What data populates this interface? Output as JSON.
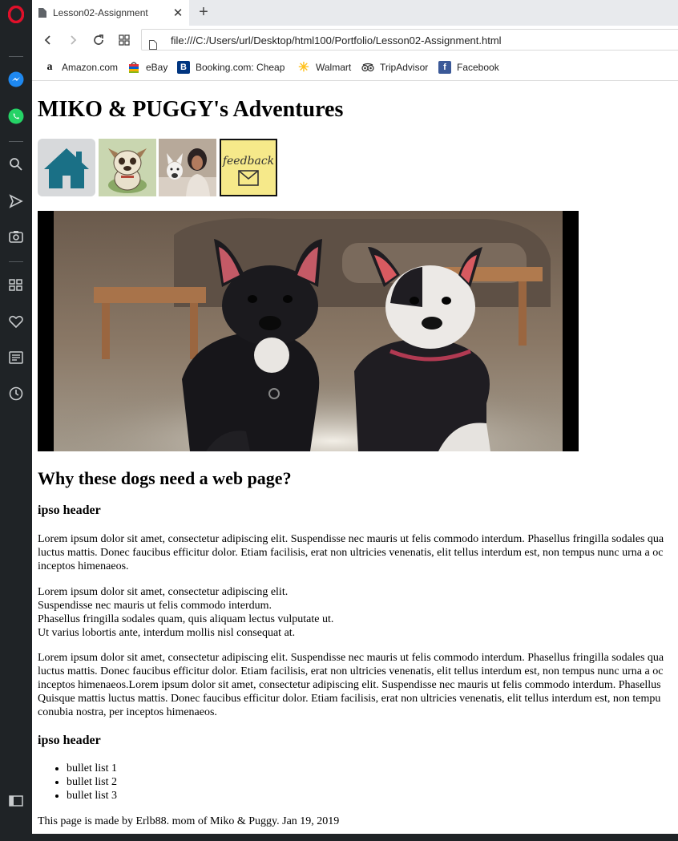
{
  "browser": {
    "tab": {
      "title": "Lesson02-Assignment",
      "close": "✕"
    },
    "new_tab": "+",
    "url": "file:///C:/Users/url/Desktop/html100/Portfolio/Lesson02-Assignment.html",
    "bookmarks": [
      {
        "label": "Amazon.com",
        "icon": "amazon-icon"
      },
      {
        "label": "eBay",
        "icon": "ebay-icon"
      },
      {
        "label": "Booking.com: Cheap",
        "icon": "booking-icon"
      },
      {
        "label": "Walmart",
        "icon": "walmart-icon"
      },
      {
        "label": "TripAdvisor",
        "icon": "tripadvisor-icon"
      },
      {
        "label": "Facebook",
        "icon": "facebook-icon"
      }
    ],
    "sidebar_icons": [
      "opera-logo-icon",
      "messenger-icon",
      "whatsapp-icon",
      "search-icon",
      "send-icon",
      "camera-icon",
      "speed-dial-icon",
      "heart-icon",
      "news-icon",
      "history-icon",
      "sidebar-toggle-icon"
    ]
  },
  "page": {
    "title": "MIKO & PUGGY's Adventures",
    "nav_images": [
      "home-icon",
      "puppy-drawing",
      "person-with-dog-photo",
      "feedback-note-icon"
    ],
    "feedback_text": "feedback",
    "h2": "Why these dogs need a web page?",
    "section1_header": "ipso header",
    "para1": [
      "Lorem ipsum dolor sit amet, consectetur adipiscing elit. Suspendisse nec mauris ut felis commodo interdum. Phasellus fringilla sodales qua",
      "luctus mattis. Donec faucibus efficitur dolor. Etiam facilisis, erat non ultricies venenatis, elit tellus interdum est, non tempus nunc urna a oc",
      "inceptos himenaeos."
    ],
    "para2": [
      "Lorem ipsum dolor sit amet, consectetur adipiscing elit.",
      "Suspendisse nec mauris ut felis commodo interdum.",
      "Phasellus fringilla sodales quam, quis aliquam lectus vulputate ut.",
      "Ut varius lobortis ante, interdum mollis nisl consequat at."
    ],
    "para3": [
      "Lorem ipsum dolor sit amet, consectetur adipiscing elit. Suspendisse nec mauris ut felis commodo interdum. Phasellus fringilla sodales qua",
      "luctus mattis. Donec faucibus efficitur dolor. Etiam facilisis, erat non ultricies venenatis, elit tellus interdum est, non tempus nunc urna a oc",
      "inceptos himenaeos.Lorem ipsum dolor sit amet, consectetur adipiscing elit. Suspendisse nec mauris ut felis commodo interdum. Phasellus",
      "Quisque mattis luctus mattis. Donec faucibus efficitur dolor. Etiam facilisis, erat non ultricies venenatis, elit tellus interdum est, non tempu",
      "conubia nostra, per inceptos himenaeos."
    ],
    "section2_header": "ipso header",
    "bullets": [
      "bullet list 1",
      "bullet list 2",
      "bullet list 3"
    ],
    "footer": "This page is made by Erlb88. mom of Miko & Puggy. Jan 19, 2019"
  }
}
